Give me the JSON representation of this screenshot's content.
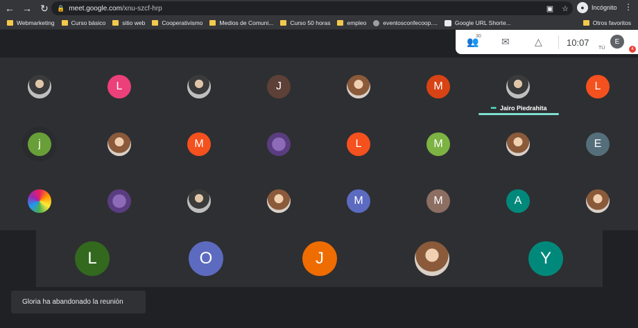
{
  "browser": {
    "url_host": "meet.google.com",
    "url_path": "/xnu-szcf-hrp",
    "incognito_label": "Incógnito",
    "bookmarks": [
      {
        "label": "Webmarketing",
        "icon": "folder-icon"
      },
      {
        "label": "Curso básico",
        "icon": "folder-icon"
      },
      {
        "label": "sitio web",
        "icon": "folder-icon"
      },
      {
        "label": "Cooperativismo",
        "icon": "folder-icon"
      },
      {
        "label": "Medios de Comuni...",
        "icon": "folder-icon"
      },
      {
        "label": "Curso 50 horas",
        "icon": "folder-icon"
      },
      {
        "label": "empleo",
        "icon": "folder-icon"
      },
      {
        "label": "eventosconfecoop....",
        "icon": "globe-icon"
      },
      {
        "label": "Google URL Shorte...",
        "icon": "google-icon"
      }
    ],
    "other_bookmarks": "Otros favoritos"
  },
  "meet_panel": {
    "participant_count": "30",
    "time": "10:07",
    "you_label": "TÚ",
    "self_initial": "E",
    "notification_count": "4"
  },
  "participants_grid": [
    {
      "initial": "",
      "kind": "photo",
      "color": "#3b3b3b"
    },
    {
      "initial": "L",
      "kind": "letter",
      "color": "#ec407a"
    },
    {
      "initial": "",
      "kind": "photo",
      "color": "#3b3b3b"
    },
    {
      "initial": "J",
      "kind": "letter",
      "color": "#5d4037"
    },
    {
      "initial": "",
      "kind": "photo2",
      "color": "#8a5a3a"
    },
    {
      "initial": "M",
      "kind": "letter",
      "color": "#d84315"
    },
    {
      "initial": "",
      "kind": "photo",
      "color": "#3b3b3b"
    },
    {
      "initial": "L",
      "kind": "letter",
      "color": "#f4511e"
    },
    {
      "initial": "j",
      "kind": "letter",
      "color": "#689f38"
    },
    {
      "initial": "",
      "kind": "photo2",
      "color": "#8a5a3a"
    },
    {
      "initial": "M",
      "kind": "letter",
      "color": "#f4511e"
    },
    {
      "initial": "",
      "kind": "purple",
      "color": "#5a3d80"
    },
    {
      "initial": "L",
      "kind": "letter",
      "color": "#f4511e"
    },
    {
      "initial": "M",
      "kind": "letter",
      "color": "#7cb342"
    },
    {
      "initial": "",
      "kind": "photo2",
      "color": "#8a5a3a"
    },
    {
      "initial": "E",
      "kind": "letter",
      "color": "#546e7a"
    },
    {
      "initial": "",
      "kind": "colorful",
      "color": "#9c27b0"
    },
    {
      "initial": "",
      "kind": "purple",
      "color": "#5a3d80"
    },
    {
      "initial": "",
      "kind": "photo",
      "color": "#3b3b3b"
    },
    {
      "initial": "",
      "kind": "photo2",
      "color": "#8a5a3a"
    },
    {
      "initial": "M",
      "kind": "letter",
      "color": "#5c6bc0"
    },
    {
      "initial": "M",
      "kind": "letter",
      "color": "#8d6e63"
    },
    {
      "initial": "A",
      "kind": "letter",
      "color": "#00897b"
    },
    {
      "initial": "",
      "kind": "photo2",
      "color": "#8a5a3a"
    }
  ],
  "active_speaker": {
    "name": "Jairo Piedrahita"
  },
  "featured": [
    {
      "initial": "L",
      "kind": "letter",
      "color": "#33691e"
    },
    {
      "initial": "O",
      "kind": "letter",
      "color": "#5c6bc0"
    },
    {
      "initial": "J",
      "kind": "letter",
      "color": "#ef6c00"
    },
    {
      "initial": "",
      "kind": "photo2",
      "color": "#8a5a3a"
    },
    {
      "initial": "Y",
      "kind": "letter",
      "color": "#00897b"
    }
  ],
  "toast": {
    "message": "Gloria ha abandonado la reunión"
  }
}
